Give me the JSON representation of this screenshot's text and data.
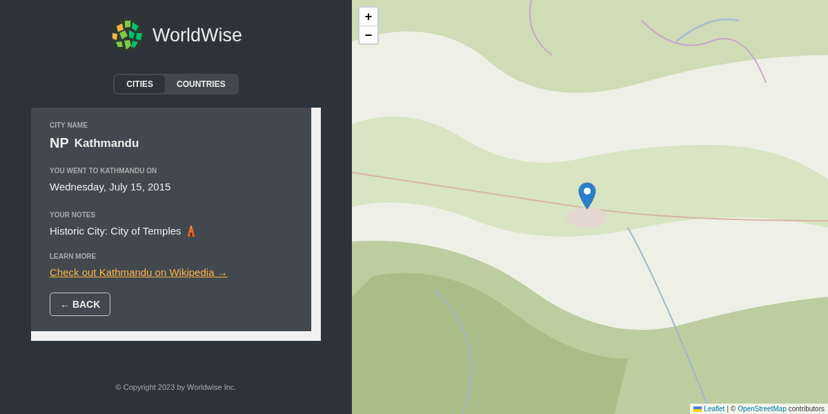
{
  "logo": {
    "name": "WorldWise"
  },
  "tabs": [
    {
      "label": "CITIES",
      "selected": true
    },
    {
      "label": "COUNTRIES",
      "selected": false
    }
  ],
  "city": {
    "name_label": "CITY NAME",
    "country_code": "NP",
    "name": "Kathmandu",
    "date_label": "YOU WENT TO KATHMANDU ON",
    "date": "Wednesday, July 15, 2015",
    "notes_label": "YOUR NOTES",
    "notes": "Historic City: City of Temples",
    "learn_label": "LEARN MORE",
    "link": "Check out Kathmandu on Wikipedia →",
    "back": "← BACK"
  },
  "footer": "© Copyright 2023 by Worldwise Inc.",
  "map": {
    "zoom_in": "+",
    "zoom_out": "−",
    "attribution": {
      "leaflet": "Leaflet",
      "separator": "| ©",
      "osm": "OpenStreetMap",
      "rest": "contributors"
    }
  }
}
